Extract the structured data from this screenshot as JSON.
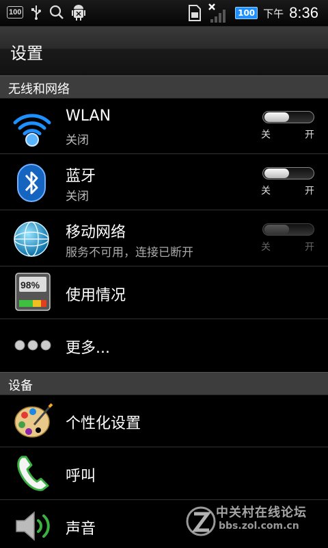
{
  "status_bar": {
    "left_icons": [
      "sd-card-icon",
      "usb-icon",
      "search-icon",
      "android-debug-icon"
    ],
    "left_badge": "100",
    "battery": "100",
    "ampm": "下午",
    "time": "8:36"
  },
  "header": {
    "title": "设置"
  },
  "sections": {
    "wireless": "无线和网络",
    "device": "设备"
  },
  "items": {
    "wlan": {
      "title": "WLAN",
      "summary": "关闭",
      "toggle_off": "关",
      "toggle_on": "开",
      "state": "off"
    },
    "bluetooth": {
      "title": "蓝牙",
      "summary": "关闭",
      "toggle_off": "关",
      "toggle_on": "开",
      "state": "off"
    },
    "mobile": {
      "title": "移动网络",
      "summary": "服务不可用，连接已断开",
      "toggle_off": "关",
      "toggle_on": "开",
      "state": "disabled"
    },
    "usage": {
      "title": "使用情况",
      "meter_text": "98%"
    },
    "more": {
      "title": "更多..."
    },
    "personalize": {
      "title": "个性化设置"
    },
    "call": {
      "title": "呼叫"
    },
    "sound": {
      "title": "声音"
    }
  },
  "watermark": {
    "line1": "中关村在线论坛",
    "line2": "bbs.zol.com.cn"
  },
  "colors": {
    "wifi_blue": "#1e90ff",
    "bluetooth_blue": "#1565c0",
    "call_green": "#3cb043",
    "section_bg": "#3d3d3d"
  }
}
